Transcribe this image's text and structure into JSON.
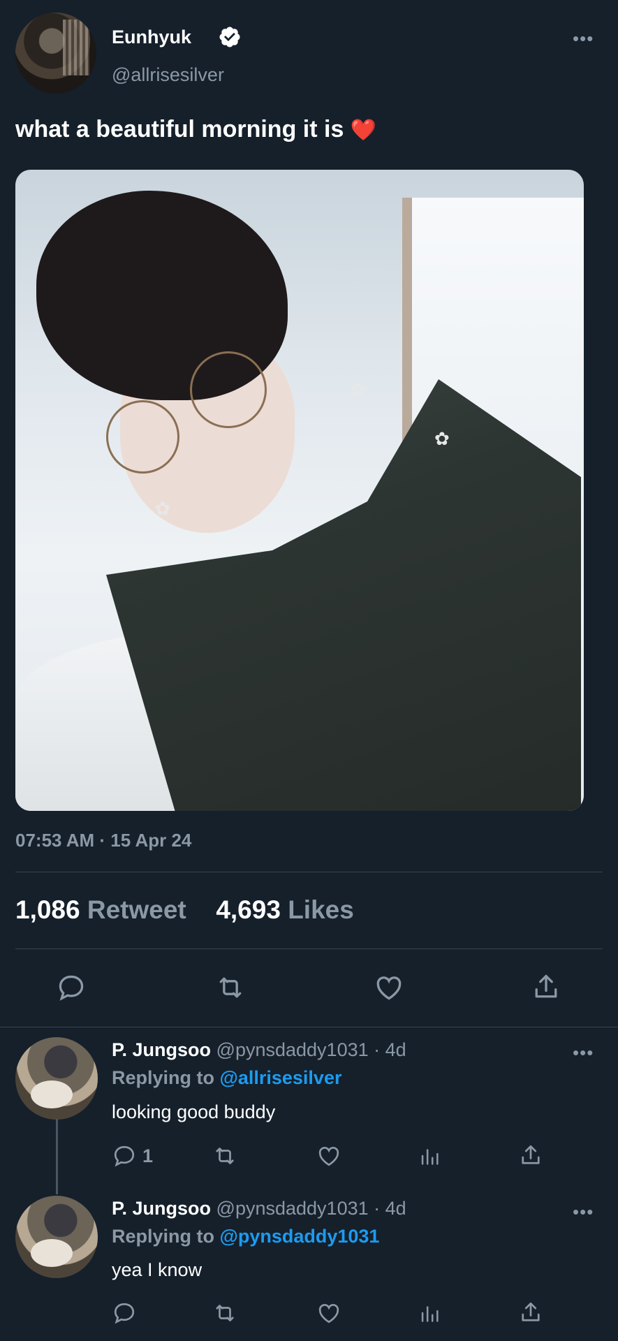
{
  "tweet": {
    "display_name": "Eunhyuk",
    "handle": "@allrisesilver",
    "text": "what a beautiful morning it is",
    "emoji": "❤️",
    "timestamp": "07:53 AM · 15 Apr 24",
    "retweet_count": "1,086",
    "retweet_label": "Retweet",
    "likes_count": "4,693",
    "likes_label": "Likes",
    "more_label": "•••",
    "verified": true
  },
  "replies": [
    {
      "display_name": "P. Jungsoo",
      "handle_time": "@pynsdaddy1031 · 4d",
      "replying_prefix": "Replying to",
      "replying_to": "@allrisesilver",
      "text": "looking good buddy",
      "reply_count": "1",
      "more_label": "•••"
    },
    {
      "display_name": "P. Jungsoo",
      "handle_time": "@pynsdaddy1031 · 4d",
      "replying_prefix": "Replying to",
      "replying_to": "@pynsdaddy1031",
      "text": "yea I know",
      "reply_count": "",
      "more_label": "•••"
    }
  ],
  "icons": {
    "reply": "reply-icon",
    "retweet": "retweet-icon",
    "like": "heart-icon",
    "share": "share-icon",
    "analytics": "analytics-icon",
    "verified": "verified-badge-icon"
  },
  "colors": {
    "background": "#15202b",
    "muted": "#8b98a5",
    "link": "#1d9bf0",
    "divider": "#38444d"
  }
}
